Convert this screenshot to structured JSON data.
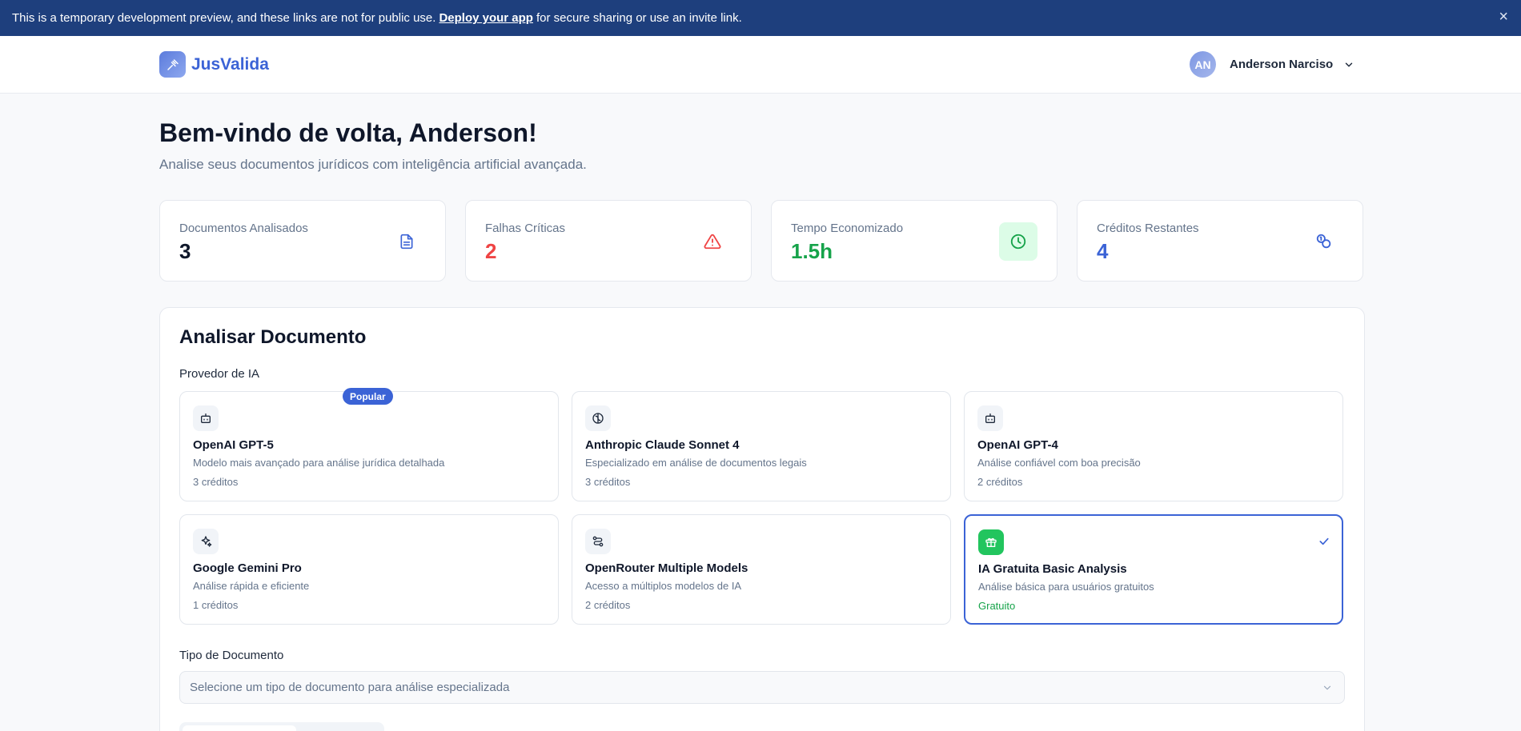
{
  "banner": {
    "text_before": "This is a temporary development preview, and these links are not for public use.",
    "link": "Deploy your app",
    "text_after": "for secure sharing or use an invite link.",
    "close": "×"
  },
  "header": {
    "app_name": "JusValida",
    "user": {
      "initials": "AN",
      "name": "Anderson Narciso"
    }
  },
  "welcome": {
    "title": "Bem-vindo de volta, Anderson!",
    "subtitle": "Analise seus documentos jurídicos com inteligência artificial avançada."
  },
  "stats": [
    {
      "label": "Documentos Analisados",
      "value": "3",
      "icon": "document-icon",
      "color": "#0f172a",
      "icon_color": "#3b63d6"
    },
    {
      "label": "Falhas Críticas",
      "value": "2",
      "icon": "warning-icon",
      "color": "#ef4444",
      "icon_color": "#ef4444"
    },
    {
      "label": "Tempo Economizado",
      "value": "1.5h",
      "icon": "clock-icon",
      "color": "#16a34a",
      "icon_color": "#16a34a"
    },
    {
      "label": "Créditos Restantes",
      "value": "4",
      "icon": "coins-icon",
      "color": "#3b63d6",
      "icon_color": "#3b63d6"
    }
  ],
  "analyze": {
    "title": "Analisar Documento",
    "provider_label": "Provedor de IA",
    "providers": [
      {
        "name": "OpenAI GPT-5",
        "desc": "Modelo mais avançado para análise jurídica detalhada",
        "cost": "3 créditos",
        "icon": "bot-icon",
        "badge": "Popular"
      },
      {
        "name": "Anthropic Claude Sonnet 4",
        "desc": "Especializado em análise de documentos legais",
        "cost": "3 créditos",
        "icon": "brain-icon"
      },
      {
        "name": "OpenAI GPT-4",
        "desc": "Análise confiável com boa precisão",
        "cost": "2 créditos",
        "icon": "bot-icon"
      },
      {
        "name": "Google Gemini Pro",
        "desc": "Análise rápida e eficiente",
        "cost": "1 créditos",
        "icon": "sparkles-icon"
      },
      {
        "name": "OpenRouter Multiple Models",
        "desc": "Acesso a múltiplos modelos de IA",
        "cost": "2 créditos",
        "icon": "route-icon"
      },
      {
        "name": "IA Gratuita Basic Analysis",
        "desc": "Análise básica para usuários gratuitos",
        "cost": "Gratuito",
        "icon": "gift-icon",
        "selected": true
      }
    ],
    "doc_type_label": "Tipo de Documento",
    "doc_type_placeholder": "Selecione um tipo de documento para análise especializada"
  },
  "colors": {
    "accent": "#3b63d6",
    "banner": "#1e3f7d",
    "success": "#22c55e",
    "danger": "#ef4444"
  }
}
